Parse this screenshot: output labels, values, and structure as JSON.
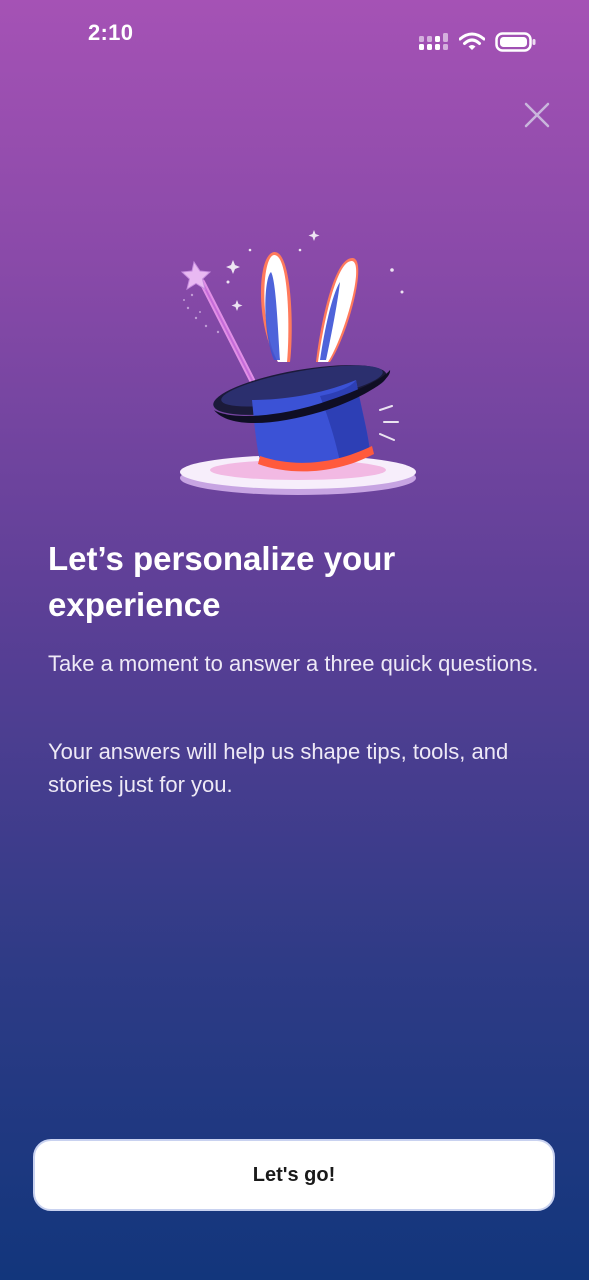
{
  "status_bar": {
    "time": "2:10",
    "icons": [
      "signal-icon",
      "wifi-icon",
      "battery-icon"
    ]
  },
  "close_icon": "close-icon",
  "illustration": "magic-hat-rabbit-illustration",
  "headline": "Let’s personalize your experience",
  "body": {
    "paragraph_1": "Take a moment to answer a three quick questions.",
    "paragraph_2": "Your answers will help us shape tips, tools, and stories just for you."
  },
  "cta": {
    "label": "Let's go!"
  },
  "colors": {
    "gradient_top": "#a552b5",
    "gradient_bottom": "#12367c",
    "button_bg": "#ffffff",
    "hat_blue": "#3b52d6"
  }
}
